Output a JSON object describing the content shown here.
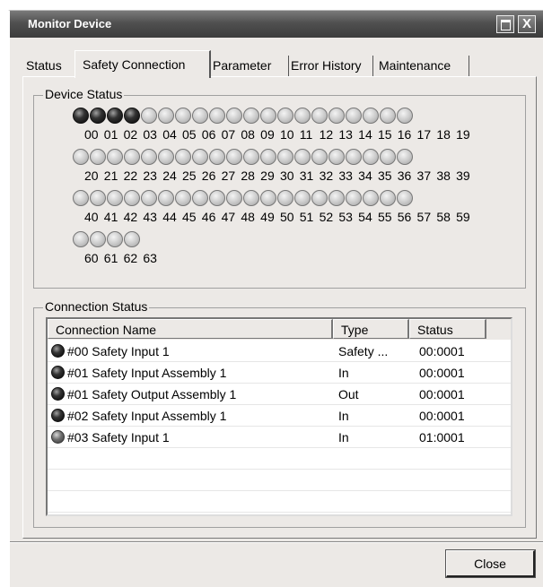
{
  "window": {
    "title": "Monitor Device",
    "close_glyph": "X"
  },
  "tabs": [
    "Status",
    "Safety Connection",
    "Parameter",
    "Error History",
    "Maintenance"
  ],
  "active_tab": "Safety Connection",
  "device_status": {
    "legend": "Device Status",
    "rows": [
      {
        "numbers": [
          "00",
          "01",
          "02",
          "03",
          "04",
          "05",
          "06",
          "07",
          "08",
          "09",
          "10",
          "11",
          "12",
          "13",
          "14",
          "15",
          "16",
          "17",
          "18",
          "19"
        ],
        "states": [
          "on",
          "on",
          "on",
          "on",
          "off",
          "off",
          "off",
          "off",
          "off",
          "off",
          "off",
          "off",
          "off",
          "off",
          "off",
          "off",
          "off",
          "off",
          "off",
          "off"
        ]
      },
      {
        "numbers": [
          "20",
          "21",
          "22",
          "23",
          "24",
          "25",
          "26",
          "27",
          "28",
          "29",
          "30",
          "31",
          "32",
          "33",
          "34",
          "35",
          "36",
          "37",
          "38",
          "39"
        ],
        "states": [
          "off",
          "off",
          "off",
          "off",
          "off",
          "off",
          "off",
          "off",
          "off",
          "off",
          "off",
          "off",
          "off",
          "off",
          "off",
          "off",
          "off",
          "off",
          "off",
          "off"
        ]
      },
      {
        "numbers": [
          "40",
          "41",
          "42",
          "43",
          "44",
          "45",
          "46",
          "47",
          "48",
          "49",
          "50",
          "51",
          "52",
          "53",
          "54",
          "55",
          "56",
          "57",
          "58",
          "59"
        ],
        "states": [
          "off",
          "off",
          "off",
          "off",
          "off",
          "off",
          "off",
          "off",
          "off",
          "off",
          "off",
          "off",
          "off",
          "off",
          "off",
          "off",
          "off",
          "off",
          "off",
          "off"
        ]
      },
      {
        "numbers": [
          "60",
          "61",
          "62",
          "63"
        ],
        "states": [
          "off",
          "off",
          "off",
          "off"
        ]
      }
    ]
  },
  "connection_status": {
    "legend": "Connection Status",
    "columns": [
      "Connection Name",
      "Type",
      "Status"
    ],
    "rows": [
      {
        "name": "#00 Safety Input 1",
        "type": "Safety ...",
        "status": "00:0001",
        "led": "on"
      },
      {
        "name": "#01 Safety Input Assembly 1",
        "type": "In",
        "status": "00:0001",
        "led": "on"
      },
      {
        "name": "#01 Safety Output Assembly 1",
        "type": "Out",
        "status": "00:0001",
        "led": "on"
      },
      {
        "name": "#02 Safety Input Assembly 1",
        "type": "In",
        "status": "00:0001",
        "led": "on"
      },
      {
        "name": "#03 Safety Input 1",
        "type": "In",
        "status": "01:0001",
        "led": "mid"
      }
    ]
  },
  "buttons": {
    "close": "Close"
  }
}
